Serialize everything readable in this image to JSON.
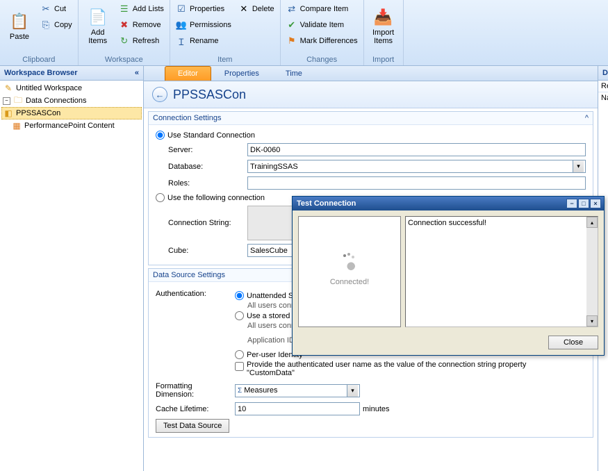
{
  "ribbon": {
    "groups": {
      "clipboard": {
        "label": "Clipboard",
        "paste": "Paste",
        "cut": "Cut",
        "copy": "Copy"
      },
      "workspace": {
        "label": "Workspace",
        "add_items": "Add\nItems",
        "add_lists": "Add Lists",
        "remove": "Remove",
        "refresh": "Refresh"
      },
      "item": {
        "label": "Item",
        "properties": "Properties",
        "permissions": "Permissions",
        "rename": "Rename",
        "delete": "Delete"
      },
      "changes": {
        "label": "Changes",
        "compare": "Compare Item",
        "validate": "Validate Item",
        "mark": "Mark Differences"
      },
      "import": {
        "label": "Import",
        "import_items": "Import\nItems"
      }
    }
  },
  "workspace": {
    "title": "Workspace Browser",
    "collapse": "«",
    "items": {
      "root": "Untitled Workspace",
      "conn_folder": "Data Connections",
      "conn_item": "PPSSASCon",
      "pp_content": "PerformancePoint Content"
    }
  },
  "tabs": {
    "editor": "Editor",
    "properties": "Properties",
    "time": "Time"
  },
  "page": {
    "title": "PPSSASCon",
    "back": "←"
  },
  "conn_settings": {
    "header": "Connection Settings",
    "chev": "☆",
    "use_standard": "Use Standard Connection",
    "server_lbl": "Server:",
    "server_val": "DK-0060",
    "database_lbl": "Database:",
    "database_val": "TrainingSSAS",
    "roles_lbl": "Roles:",
    "roles_val": "",
    "use_following": "Use the following connection",
    "connstr_lbl": "Connection String:",
    "cube_lbl": "Cube:",
    "cube_val": "SalesCube"
  },
  "ds_settings": {
    "header": "Data Source Settings",
    "auth_lbl": "Authentication:",
    "opt_unattended": "Unattended Service Account",
    "opt_unattended_sub": "All users connect using the credentials of the Unattended Service Account",
    "opt_stored": "Use a stored account",
    "opt_stored_sub": "All users connect using the credentials of a shared account",
    "appid_lbl": "Application ID:",
    "opt_peruser": "Per-user Identity",
    "chk_custom": "Provide the authenticated user name as the value of the connection string property \"CustomData\"",
    "fmt_lbl": "Formatting Dimension:",
    "fmt_val": "Measures",
    "cache_lbl": "Cache Lifetime:",
    "cache_val": "10",
    "cache_unit": "minutes",
    "test_btn": "Test Data Source"
  },
  "details": {
    "title": "Details",
    "related": "Related",
    "name": "Name"
  },
  "dialog": {
    "title": "Test Connection",
    "status": "Connected!",
    "message": "Connection successful!",
    "close": "Close"
  }
}
